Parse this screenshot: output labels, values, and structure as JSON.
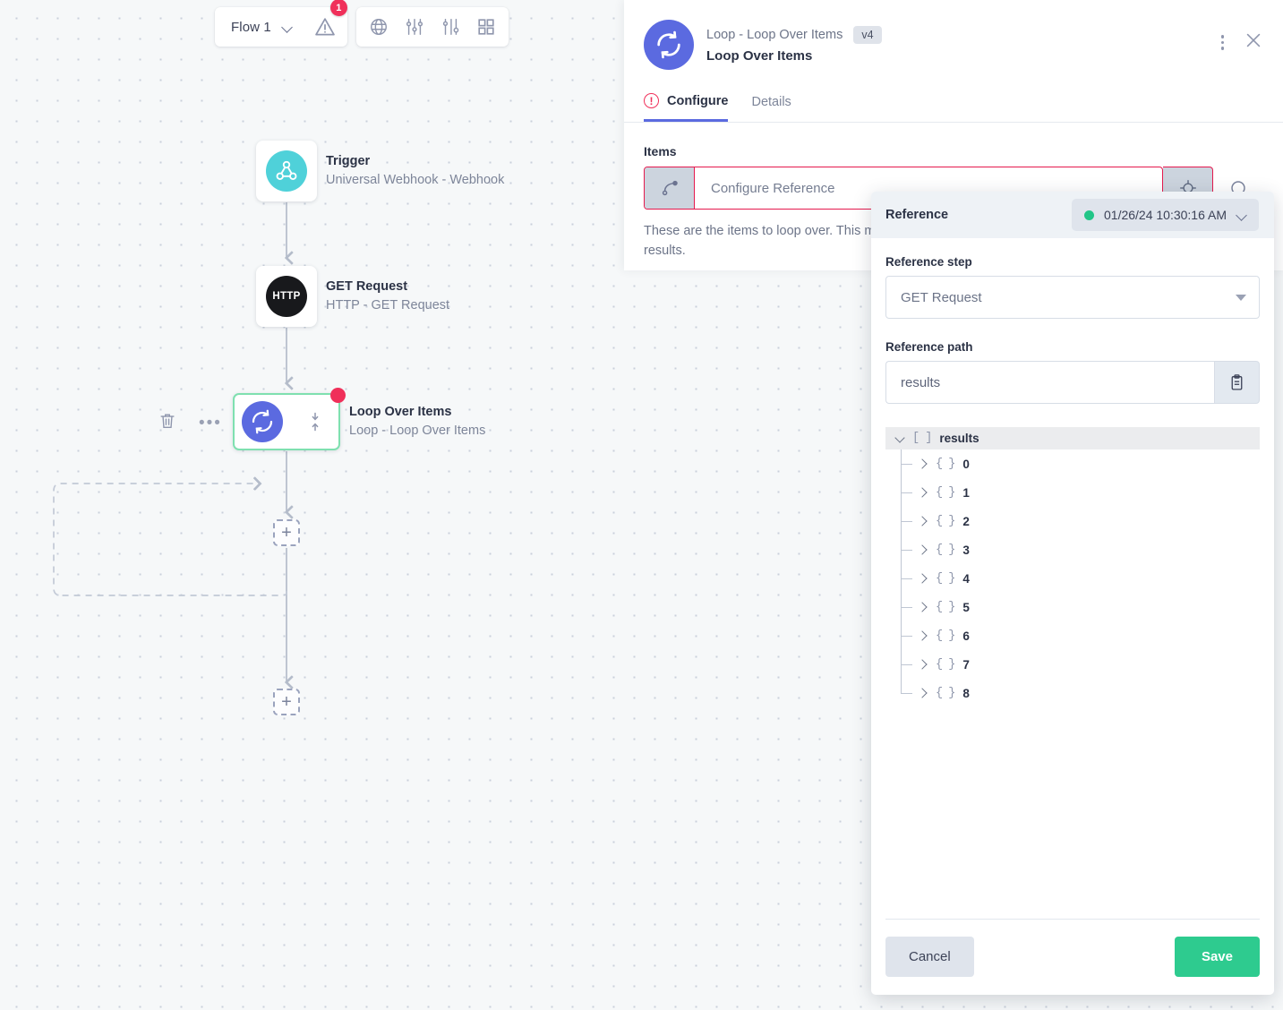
{
  "toolbar": {
    "flow_name": "Flow 1",
    "warning_count": "1",
    "icons": [
      "globe-icon",
      "sliders-icon",
      "filter-settings-icon",
      "grid-icon"
    ]
  },
  "canvas": {
    "nodes": [
      {
        "title": "Trigger",
        "subtitle": "Universal Webhook - Webhook",
        "icon": "webhook-icon"
      },
      {
        "title": "GET Request",
        "subtitle": "HTTP - GET Request",
        "icon": "http-icon",
        "icon_text": "HTTP"
      },
      {
        "title": "Loop Over Items",
        "subtitle": "Loop - Loop Over Items",
        "icon": "loop-icon",
        "selected": true,
        "has_error": true
      }
    ],
    "add_buttons": [
      "+",
      "+"
    ],
    "hover_tools": [
      "delete-icon",
      "more-options-icon"
    ]
  },
  "panel": {
    "subtitle": "Loop - Loop Over Items",
    "version": "v4",
    "title": "Loop Over Items",
    "tabs": [
      {
        "label": "Configure",
        "active": true,
        "error": true
      },
      {
        "label": "Details",
        "active": false
      }
    ],
    "field": {
      "label": "Items",
      "placeholder": "Configure Reference",
      "help": "These are the items to loop over. This must be an array from a previous step's results."
    }
  },
  "modal": {
    "title": "Reference",
    "run_timestamp": "01/26/24 10:30:16 AM",
    "status_color": "#22c587",
    "step_label": "Reference step",
    "step_value": "GET Request",
    "path_label": "Reference path",
    "path_value": "results",
    "tree": {
      "root_name": "results",
      "root_type": "[ ]",
      "children": [
        {
          "type": "{ }",
          "name": "0"
        },
        {
          "type": "{ }",
          "name": "1"
        },
        {
          "type": "{ }",
          "name": "2"
        },
        {
          "type": "{ }",
          "name": "3"
        },
        {
          "type": "{ }",
          "name": "4"
        },
        {
          "type": "{ }",
          "name": "5"
        },
        {
          "type": "{ }",
          "name": "6"
        },
        {
          "type": "{ }",
          "name": "7"
        },
        {
          "type": "{ }",
          "name": "8"
        }
      ]
    },
    "cancel_label": "Cancel",
    "save_label": "Save"
  }
}
